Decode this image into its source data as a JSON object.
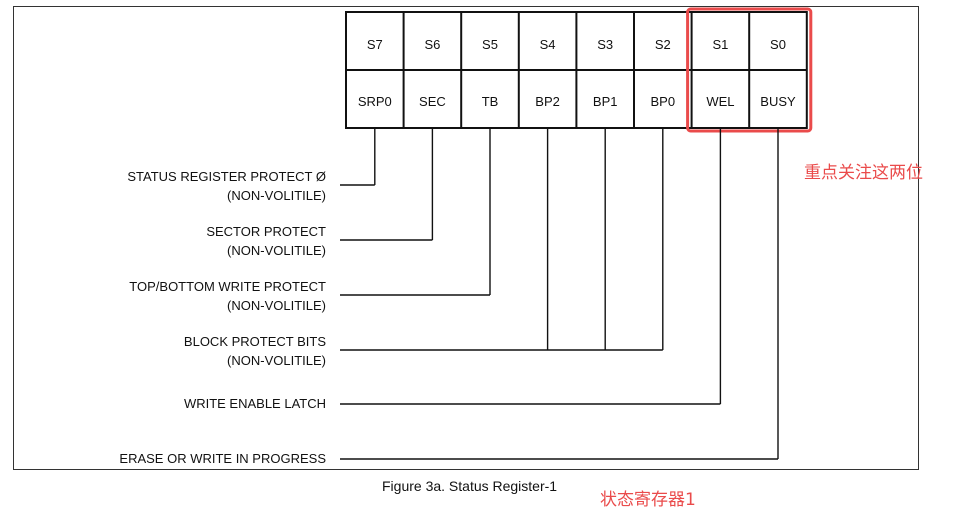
{
  "register": {
    "top_row": [
      "S7",
      "S6",
      "S5",
      "S4",
      "S3",
      "S2",
      "S1",
      "S0"
    ],
    "bottom_row": [
      "SRP0",
      "SEC",
      "TB",
      "BP2",
      "BP1",
      "BP0",
      "WEL",
      "BUSY"
    ]
  },
  "labels": [
    {
      "line1": "STATUS REGISTER PROTECT Ø",
      "line2": "(NON-VOLITILE)",
      "bits": [
        0
      ]
    },
    {
      "line1": "SECTOR PROTECT",
      "line2": "(NON-VOLITILE)",
      "bits": [
        1
      ]
    },
    {
      "line1": "TOP/BOTTOM WRITE PROTECT",
      "line2": "(NON-VOLITILE)",
      "bits": [
        2
      ]
    },
    {
      "line1": "BLOCK PROTECT BITS",
      "line2": "(NON-VOLITILE)",
      "bits": [
        3,
        4,
        5
      ]
    },
    {
      "line1": "WRITE ENABLE LATCH",
      "line2": "",
      "bits": [
        6
      ]
    },
    {
      "line1": "ERASE OR WRITE IN PROGRESS",
      "line2": "",
      "bits": [
        7
      ]
    }
  ],
  "caption": "Figure 3a. Status Register-1",
  "annotations": {
    "focus_note": "重点关注这两位",
    "caption_note": "状态寄存器1",
    "color": "#ea4b4b"
  }
}
